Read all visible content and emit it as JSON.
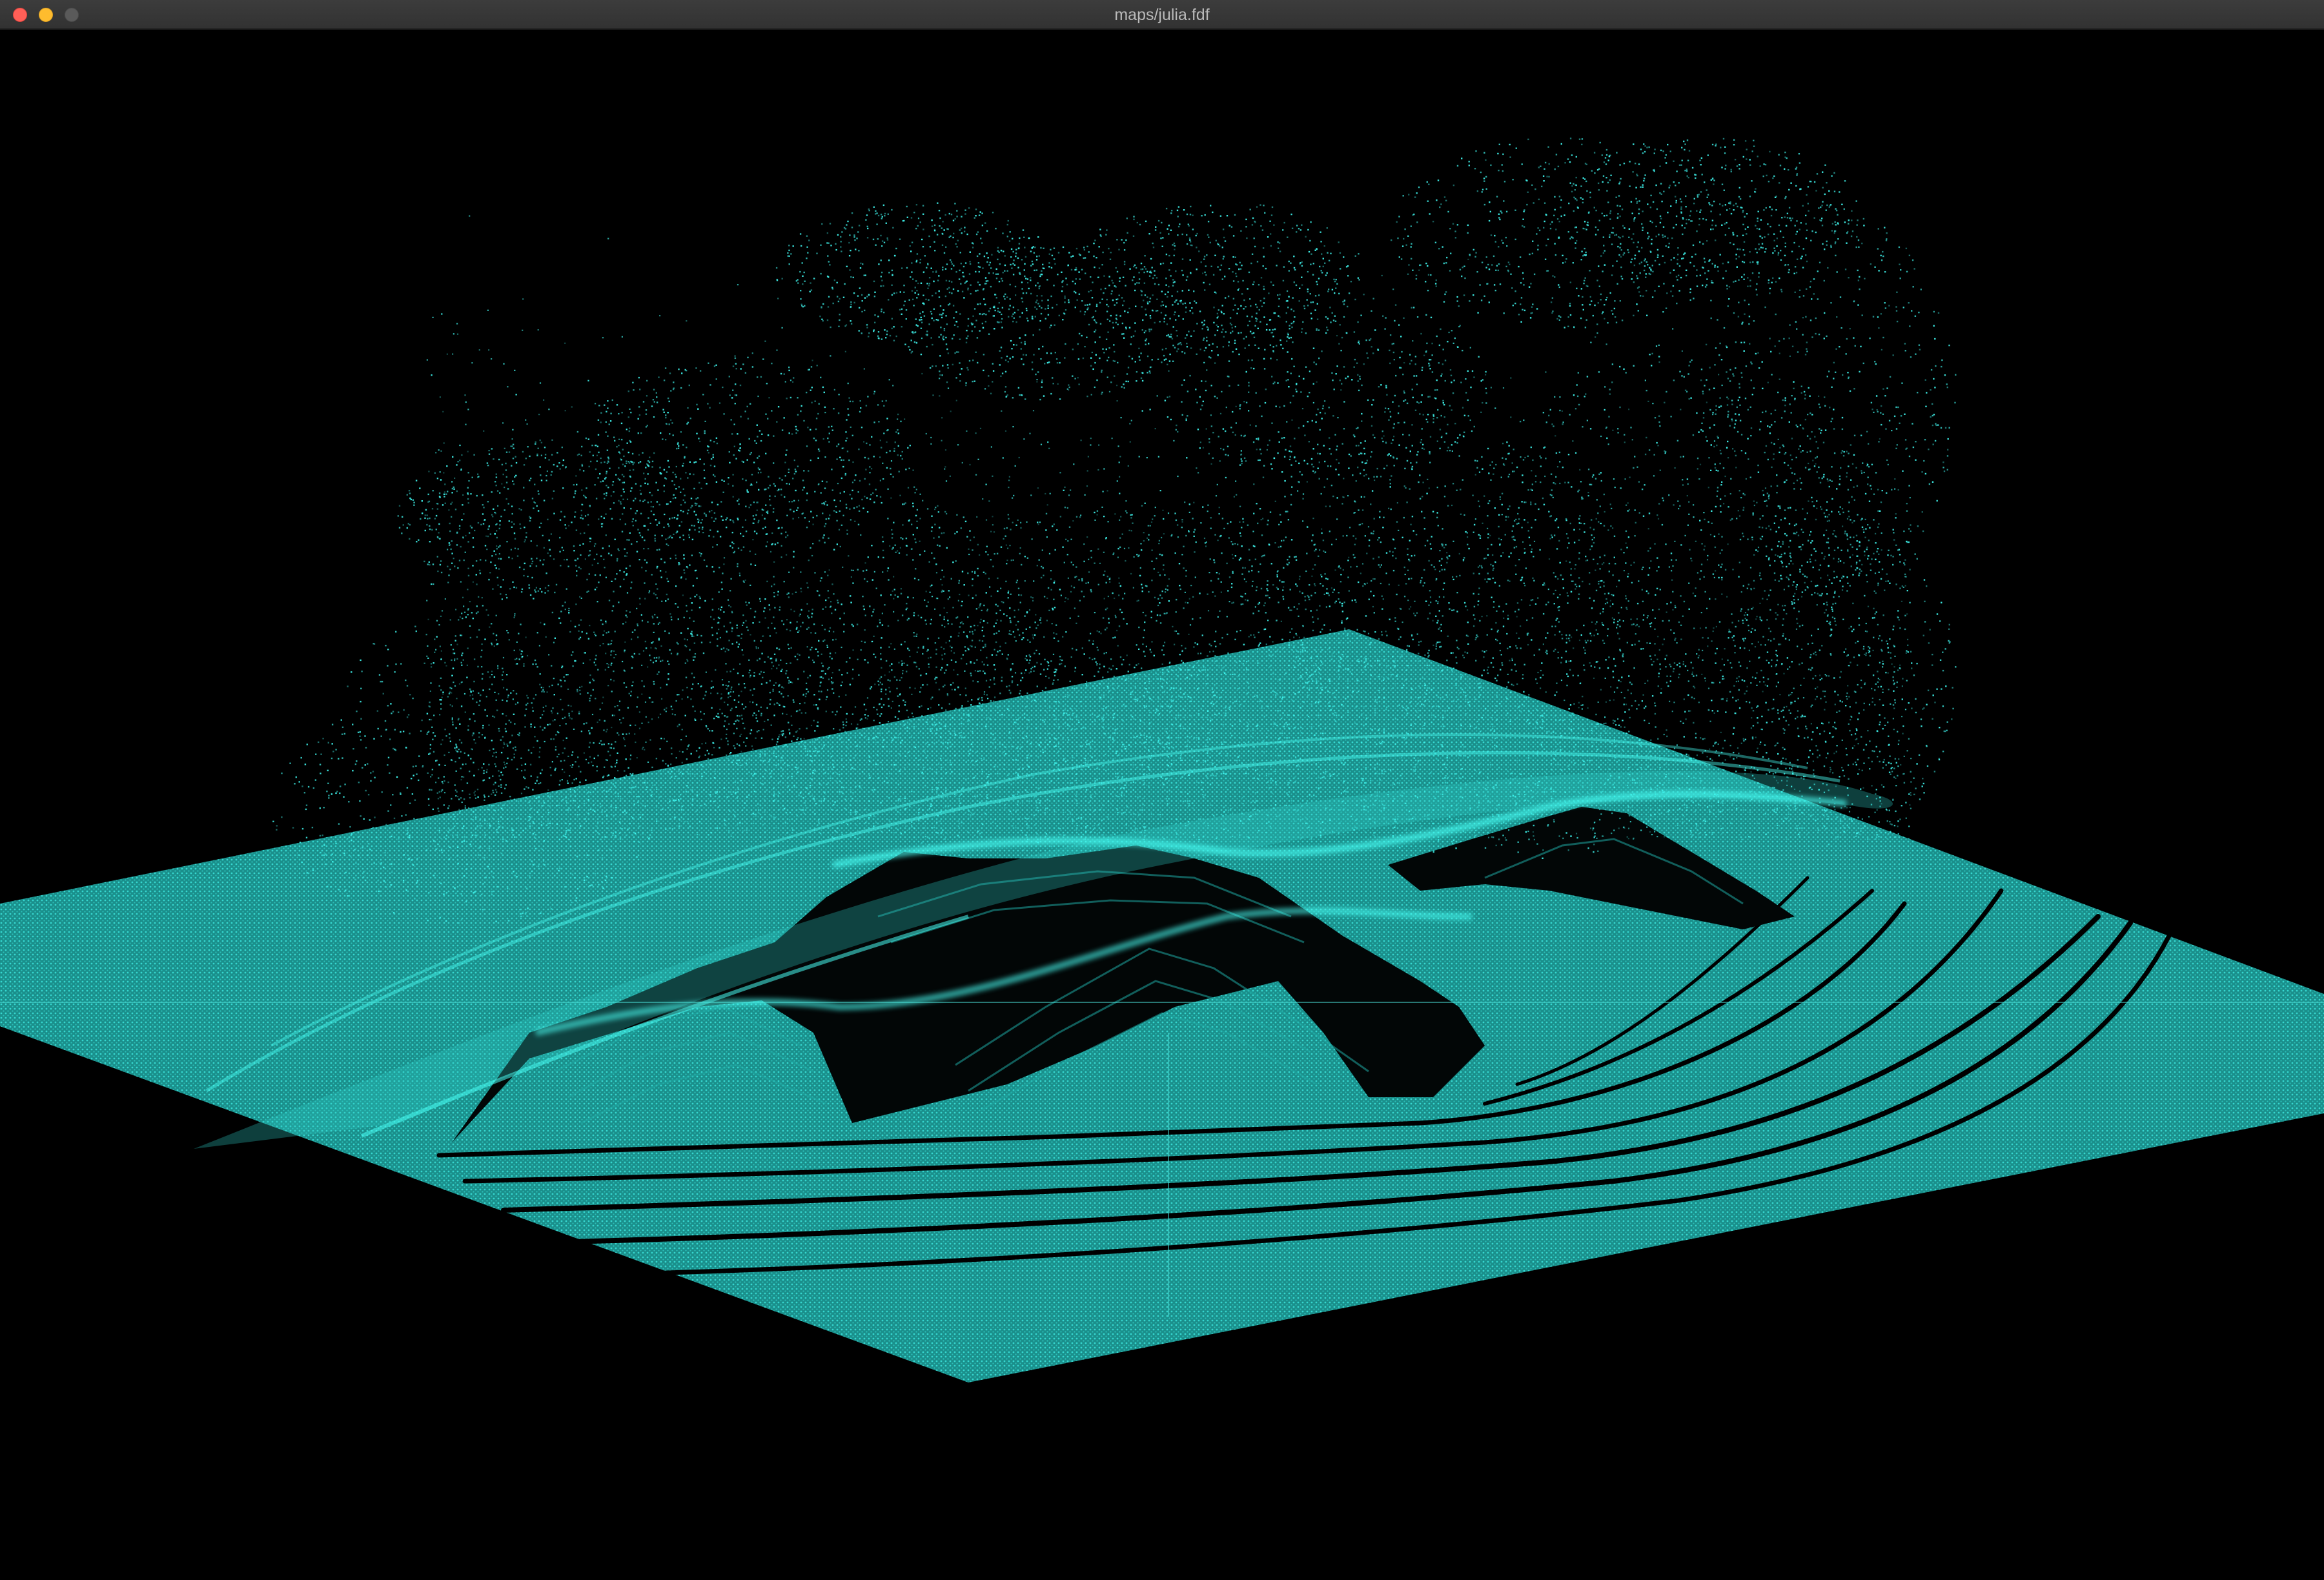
{
  "window": {
    "title": "maps/julia.fdf",
    "controls": [
      "close",
      "minimize",
      "zoom"
    ]
  },
  "render": {
    "description_color": "#00e5e0",
    "plane_color": "#1fa7a2",
    "plane_highlight": "#27c3bd",
    "spray_color": "#3ff5ee",
    "background": "#000000"
  }
}
